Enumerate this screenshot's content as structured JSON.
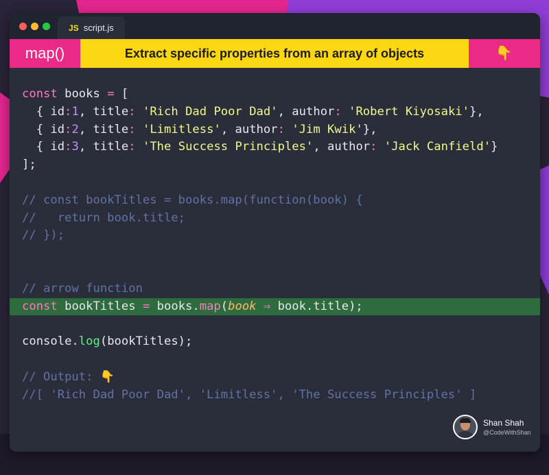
{
  "editor": {
    "tab_icon": "JS",
    "tab_name": "script.js"
  },
  "banner": {
    "method": "map()",
    "title": "Extract specific properties from an array of objects",
    "pointer_icon": "pointing-down-hand-icon"
  },
  "code": {
    "l1_kw": "const",
    "l1_name": " books ",
    "l1_eq": "=",
    "l1_br": " [",
    "l2_open": "  { ",
    "l2_id": "id",
    "l2_c1": ":",
    "l2_n": "1",
    "l2_comma1": ", ",
    "l2_title": "title",
    "l2_c2": ": ",
    "l2_str1": "'Rich Dad Poor Dad'",
    "l2_comma2": ", ",
    "l2_author": "author",
    "l2_c3": ": ",
    "l2_str2": "'Robert Kiyosaki'",
    "l2_close": "},",
    "l3_open": "  { ",
    "l3_id": "id",
    "l3_c1": ":",
    "l3_n": "2",
    "l3_comma1": ", ",
    "l3_title": "title",
    "l3_c2": ": ",
    "l3_str1": "'Limitless'",
    "l3_comma2": ", ",
    "l3_author": "author",
    "l3_c3": ": ",
    "l3_str2": "'Jim Kwik'",
    "l3_close": "},",
    "l4_open": "  { ",
    "l4_id": "id",
    "l4_c1": ":",
    "l4_n": "3",
    "l4_comma1": ", ",
    "l4_title": "title",
    "l4_c2": ": ",
    "l4_str1": "'The Success Principles'",
    "l4_comma2": ", ",
    "l4_author": "author",
    "l4_c3": ": ",
    "l4_str2": "'Jack Canfield'",
    "l4_close": "}",
    "l5": "];",
    "l6": "",
    "l7": "// const bookTitles = books.map(function(book) {",
    "l8": "//   return book.title;",
    "l9": "// });",
    "l10": "",
    "l11": "",
    "l12": "// arrow function",
    "l13_kw": "const",
    "l13_name": " bookTitles ",
    "l13_eq": "=",
    "l13_obj": " books.",
    "l13_fn": "map",
    "l13_paren": "(",
    "l13_param": "book",
    "l13_arrow": " ⇒ ",
    "l13_rest": "book.title);",
    "l14": "",
    "l15_obj": "console.",
    "l15_fn": "log",
    "l15_rest": "(bookTitles);",
    "l16": "",
    "l17_text": "// Output: ",
    "l17_icon": "pointing-down-hand-icon",
    "l18": "//[ 'Rich Dad Poor Dad', 'Limitless', 'The Success Principles' ]"
  },
  "author": {
    "name": "Shan Shah",
    "handle": "@CodeWithShan"
  },
  "colors": {
    "banner_pink": "#ea2a86",
    "banner_yellow": "#fcd712",
    "editor_bg": "#2a2d3a",
    "highlight_green": "#2e6b3e",
    "keyword": "#ff79c6",
    "string": "#f1fa8c",
    "number": "#bd93f9",
    "comment": "#6272a4",
    "function": "#50fa7b",
    "parameter": "#ffb86c"
  }
}
